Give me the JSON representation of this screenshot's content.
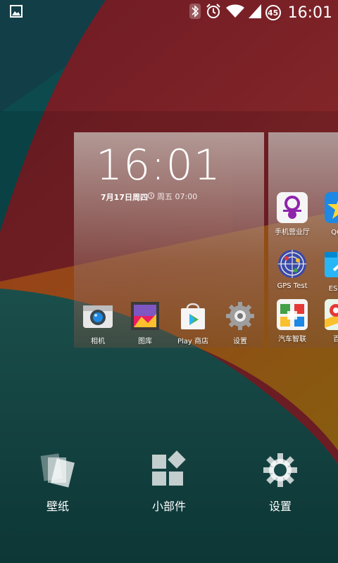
{
  "status_bar": {
    "left_icon": "image-notification-icon",
    "icons": [
      "bluetooth-icon",
      "alarm-icon",
      "wifi-icon",
      "signal-icon"
    ],
    "battery_level": "45",
    "time": "16:01"
  },
  "clock_widget": {
    "time": "16:01",
    "date": "7月17日周四",
    "alarm": "周五 07:00"
  },
  "main_page_apps": [
    {
      "label": "相机",
      "icon": "camera-icon"
    },
    {
      "label": "图库",
      "icon": "gallery-icon"
    },
    {
      "label": "Play 商店",
      "icon": "play-store-icon"
    },
    {
      "label": "设置",
      "icon": "settings-icon"
    }
  ],
  "right_page_apps": [
    {
      "label": "手机营业厅",
      "icon": "china-unicom-icon"
    },
    {
      "label": "QQ空",
      "icon": "qq-zone-icon"
    },
    {
      "label": "GPS Test",
      "icon": "gps-test-icon"
    },
    {
      "label": "ES文件",
      "icon": "es-file-icon"
    },
    {
      "label": "汽车智联",
      "icon": "car-connect-icon"
    },
    {
      "label": "百度",
      "icon": "baidu-map-icon"
    }
  ],
  "bottom_options": [
    {
      "label": "壁纸",
      "icon": "wallpaper-icon"
    },
    {
      "label": "小部件",
      "icon": "widgets-icon"
    },
    {
      "label": "设置",
      "icon": "settings-gear-icon"
    }
  ]
}
